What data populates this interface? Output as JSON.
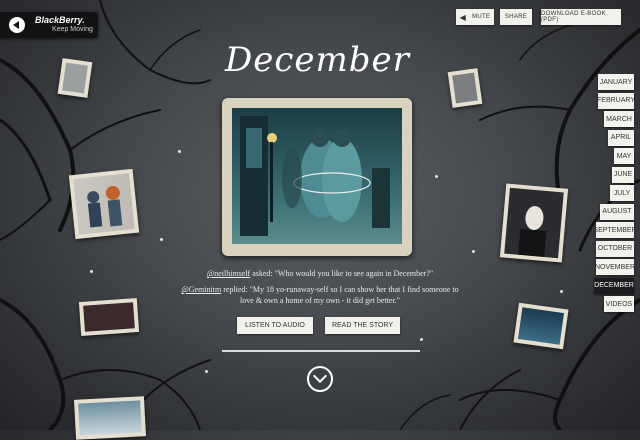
{
  "brand": {
    "name": "BlackBerry.",
    "tagline": "Keep Moving"
  },
  "top_actions": {
    "mute": "MUTE",
    "share": "SHARE",
    "download": "DOWNLOAD E-BOOK (PDF)"
  },
  "page_title": "December",
  "months": [
    "JANUARY",
    "FEBRUARY",
    "MARCH",
    "APRIL",
    "MAY",
    "JUNE",
    "JULY",
    "AUGUST",
    "SEPTEMBER",
    "OCTOBER",
    "NOVEMBER",
    "DECEMBER",
    "VIDEOS"
  ],
  "active_month": "DECEMBER",
  "question": {
    "handle": "@neilhimself",
    "text": " asked: \"Who would you like to see again in December?\""
  },
  "reply": {
    "handle": "@Geminitm",
    "text": " replied: \"My 18 yo-runaway-self so I can show her that I find someone to love & own a home of my own - it did get better.\""
  },
  "buttons": {
    "listen": "LISTEN TO AUDIO",
    "read": "READ THE STORY"
  },
  "colors": {
    "accent_dark": "#1b1c1e",
    "button_bg": "#f3f1ec",
    "frame": "#d9d2bf"
  }
}
